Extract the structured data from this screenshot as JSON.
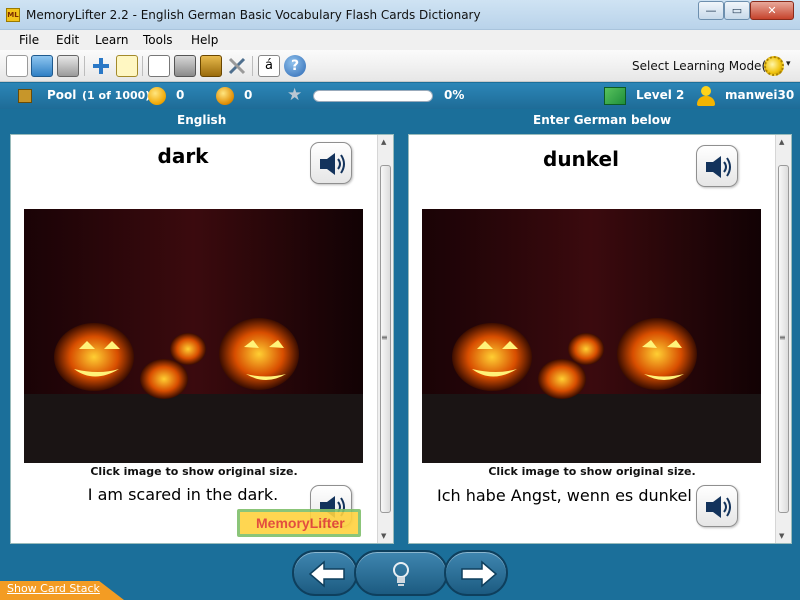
{
  "window": {
    "app_icon_text": "ML",
    "title": "MemoryLifter 2.2 - English German Basic Vocabulary Flash Cards Dictionary",
    "min": "—",
    "max": "▭",
    "close": "✕"
  },
  "menu": [
    "File",
    "Edit",
    "Learn",
    "Tools",
    "Help"
  ],
  "toolbar": {
    "icons": [
      "new-icon",
      "open-icon",
      "print-icon",
      "add-icon",
      "edit-icon",
      "presentation-icon",
      "settings-icon",
      "archive-icon",
      "tools-icon",
      "font-icon",
      "help-icon"
    ],
    "font_glyph": "á",
    "help_glyph": "?",
    "mode_label": "Select Learning Mode(s)",
    "mode_caret": "▾"
  },
  "status": {
    "pool_label": "Pool",
    "pool_count": "(1 of 1000)",
    "correct_count": "0",
    "wrong_count": "0",
    "progress_percent": 0,
    "progress_text": "0%",
    "level": "Level 2",
    "user": "manwei30"
  },
  "panels": {
    "left_header": "English",
    "right_header": "Enter German below",
    "left_word": "dark",
    "right_word": "dunkel",
    "hint_text": "Click image to show original size.",
    "left_sentence": "I am scared in the dark.",
    "right_sentence": "Ich habe Angst, wenn es dunkel ist.",
    "logo_text": "MemoryLifter"
  },
  "footer": {
    "show_card_stack": "Show Card Stack"
  },
  "colors": {
    "background": "#1b6f9a",
    "pumpkin": "#ff8a00"
  }
}
